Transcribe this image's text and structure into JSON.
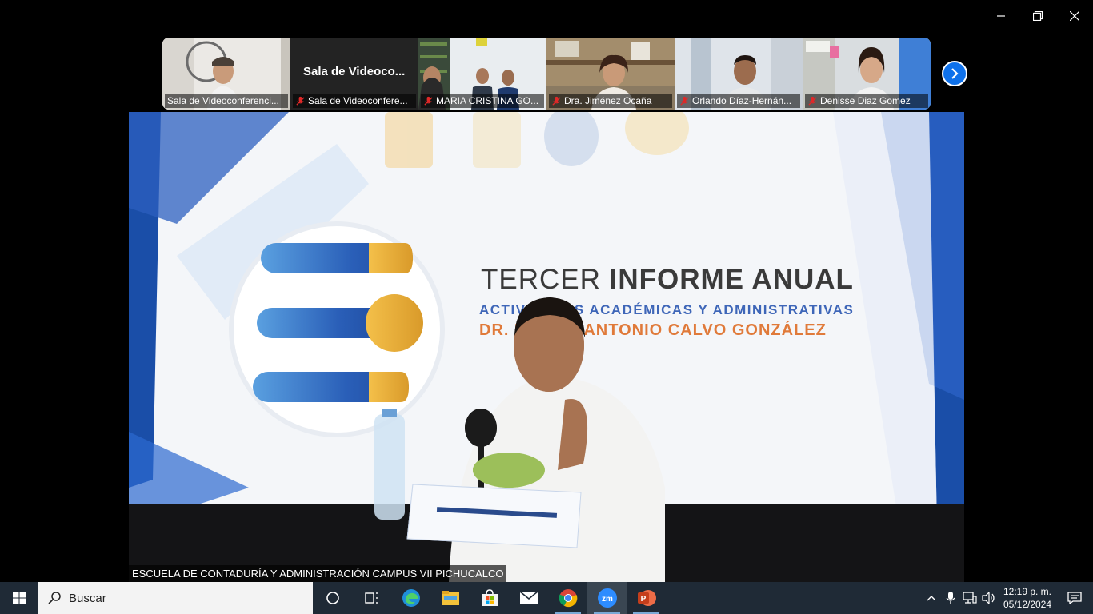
{
  "window": {
    "controls": [
      "minimize-icon",
      "restore-icon",
      "close-icon"
    ]
  },
  "participants": [
    {
      "name": "Sala de Videoconferenci...",
      "muted": false
    },
    {
      "name": "Sala de Videoconfere...",
      "muted": true,
      "big_name": "Sala de Videoco..."
    },
    {
      "name": "MARIA CRISTINA GO...",
      "muted": true
    },
    {
      "name": "Dra. Jiménez Ocaña",
      "muted": true
    },
    {
      "name": "Orlando Díaz-Hernán...",
      "muted": true
    },
    {
      "name": "Denisse Diaz Gomez",
      "muted": true
    }
  ],
  "main_video": {
    "speaker_label": "ESCUELA DE CONTADURÍA Y ADMINISTRACIÓN CAMPUS VII PICHUCALCO",
    "banner": {
      "title_light": "TERCER ",
      "title_bold": "INFORME ANUAL",
      "subtitle": "ACTIVIDADES ACADÉMICAS Y ADMINISTRATIVAS",
      "name": "DR. MARCO ANTONIO CALVO GONZÁLEZ"
    }
  },
  "taskbar": {
    "search_placeholder": "Buscar",
    "apps": [
      "task-view-icon",
      "edge-icon",
      "file-explorer-icon",
      "store-icon",
      "mail-icon",
      "chrome-icon",
      "zoom-icon",
      "powerpoint-icon"
    ],
    "clock_time": "12:19 p. m.",
    "clock_date": "05/12/2024"
  },
  "colors": {
    "accent": "#0e71eb",
    "taskbar": "#1f2a36",
    "muted_mic": "#e02828"
  }
}
